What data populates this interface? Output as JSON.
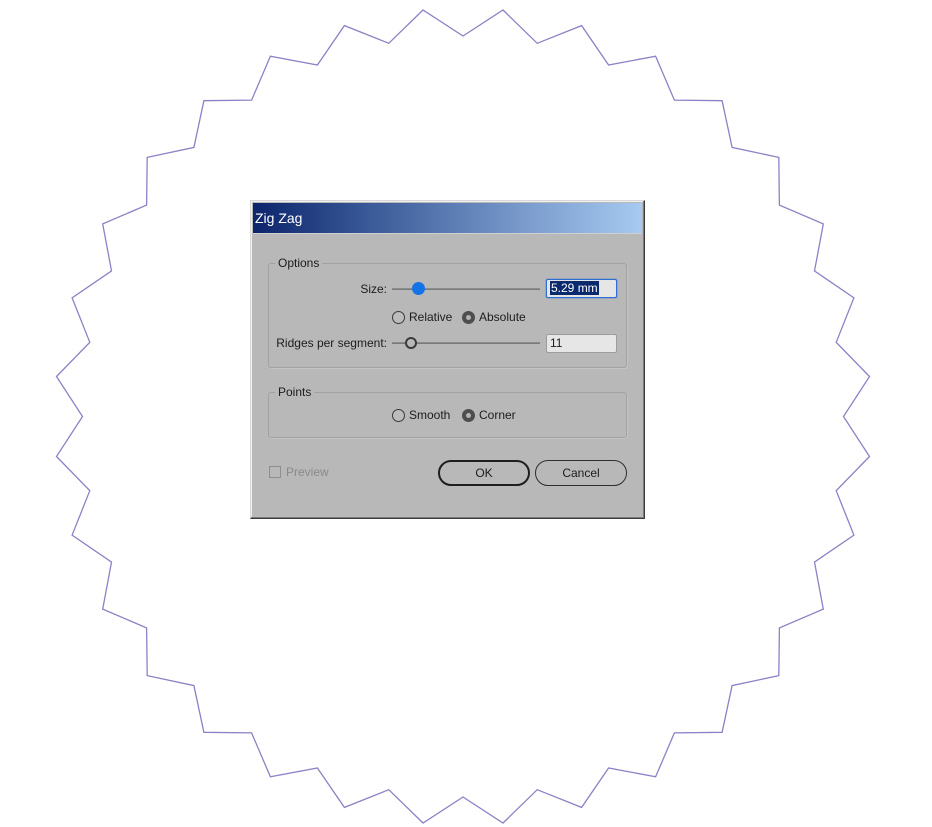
{
  "canvas": {
    "shape_stroke_color": "#8a82c6"
  },
  "dialog": {
    "title": "Zig Zag",
    "options_group": {
      "label": "Options",
      "size": {
        "label": "Size:",
        "value": "5.29 mm",
        "slider_fraction": 0.18
      },
      "mode_radios": [
        {
          "label": "Relative",
          "checked": false
        },
        {
          "label": "Absolute",
          "checked": true
        }
      ],
      "ridges": {
        "label": "Ridges per segment:",
        "value": "11",
        "slider_fraction": 0.13
      }
    },
    "points_group": {
      "label": "Points",
      "radios": [
        {
          "label": "Smooth",
          "checked": false
        },
        {
          "label": "Corner",
          "checked": true
        }
      ]
    },
    "preview": {
      "label": "Preview",
      "checked": false,
      "disabled": true
    },
    "buttons": {
      "ok": "OK",
      "cancel": "Cancel"
    },
    "colors": {
      "title_gradient_start": "#0c246b",
      "title_gradient_end": "#a6caf0",
      "slider_thumb_active": "#1473e6",
      "text_selection": "#0b2a6e"
    }
  }
}
